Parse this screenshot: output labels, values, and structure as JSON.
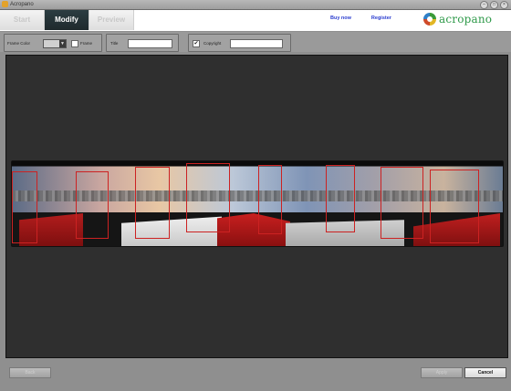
{
  "window": {
    "title": "Acropano",
    "controls": [
      "–",
      "□",
      "×"
    ]
  },
  "header": {
    "tabs": [
      {
        "label": "Start",
        "active": false
      },
      {
        "label": "Modify",
        "active": true
      },
      {
        "label": "Preview",
        "active": false
      }
    ],
    "links": {
      "buy_now": "Buy now",
      "register": "Register"
    },
    "logo_text": "acropano"
  },
  "toolbar": {
    "frame_color_label": "Frame Color",
    "frame_label": "Frame",
    "frame_checked": false,
    "title_label": "Title",
    "title_value": "",
    "copyright_label": "Copyright",
    "copyright_checked": true,
    "copyright_value": ""
  },
  "footer": {
    "back_label": "Back",
    "apply_label": "Apply",
    "cancel_label": "Cancel"
  },
  "colors": {
    "active_tab": "#1f2a2d",
    "link": "#2a3ccf",
    "frame_red": "#cc2222"
  }
}
